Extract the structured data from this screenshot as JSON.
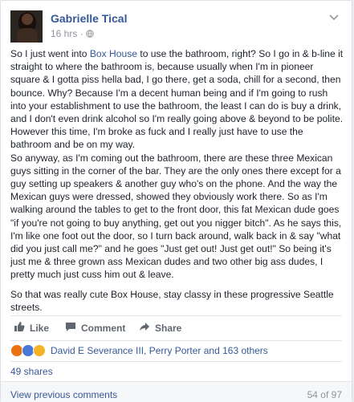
{
  "author": {
    "name": "Gabrielle Tical",
    "timestamp": "16 hrs",
    "privacy_icon": "globe-icon"
  },
  "post": {
    "paragraph1_before_link": "So I just went into ",
    "link_text": "Box House",
    "paragraph1_after_link": " to use the bathroom, right? So I go in & b-line it straight to where the bathroom is, because usually when I'm in pioneer square & I gotta piss hella bad, I go there, get a soda, chill for a second, then bounce. Why? Because I'm a decent human being and if I'm going to rush into your establishment to use the bathroom, the least I can do is buy a drink, and I don't even drink alcohol so I'm really going above & beyond to be polite. However this time, I'm broke as fuck and I really just have to use the bathroom and be on my way.\nSo anyway, as I'm coming out the bathroom, there are these three Mexican guys sitting in the corner of the bar. They are the only ones there except for a guy setting up speakers & another guy who's on the phone. And the way the Mexican guys were dressed, showed they obviously work there. So as I'm walking around the tables to get to the front door, this fat Mexican dude goes \"if you're not going to buy anything, get out you nigger bitch\". As he says this, I'm like one foot out the door, so I turn back around, walk back in & say \"what did you just call me?\" and he goes \"Just get out! Just get out!\" So being it's just me & three grown ass Mexican dudes and two other big ass dudes, I pretty much just cuss him out & leave.",
    "paragraph2": "So that was really cute Box House, stay classy in these progressive Seattle streets."
  },
  "actions": {
    "like": "Like",
    "comment": "Comment",
    "share": "Share"
  },
  "reactions": {
    "summary": "David E Severance III, Perry Porter and 163 others",
    "colors": {
      "angry": "#e9710f",
      "like": "#4a76d6",
      "wow": "#f7b125"
    }
  },
  "shares": "49 shares",
  "comments": {
    "view_previous": "View previous comments",
    "count": "54 of 97"
  }
}
